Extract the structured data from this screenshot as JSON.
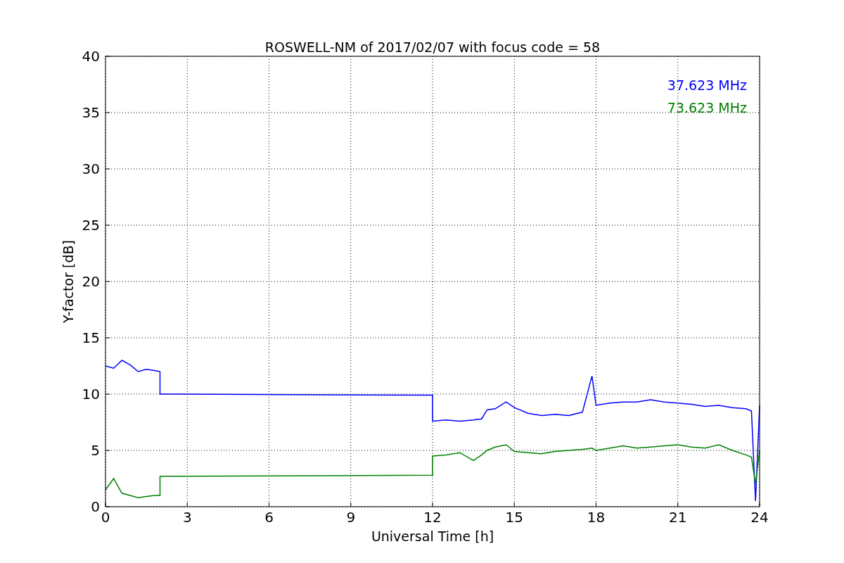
{
  "figure": {
    "chart_data": {
      "type": "line",
      "title": "ROSWELL-NM of 2017/02/07 with focus code = 58",
      "xlabel": "Universal Time [h]",
      "ylabel": "Y-factor [dB]",
      "x": [
        0,
        0.3,
        0.6,
        0.9,
        1.2,
        1.5,
        1.8,
        2,
        2,
        12,
        12,
        12.5,
        13,
        13.5,
        13.8,
        14,
        14.3,
        14.7,
        15,
        15.5,
        16,
        16.5,
        17,
        17.5,
        17.85,
        18,
        18.5,
        19,
        19.5,
        20,
        20.5,
        21,
        21.5,
        22,
        22.5,
        23,
        23.5,
        23.7,
        23.85,
        24
      ],
      "series": [
        {
          "name": "37.623 MHz",
          "color": "#0000ff",
          "values": [
            12.5,
            12.3,
            13.0,
            12.6,
            12.0,
            12.2,
            12.1,
            12.0,
            10.0,
            9.9,
            7.6,
            7.7,
            7.6,
            7.7,
            7.8,
            8.6,
            8.7,
            9.3,
            8.8,
            8.3,
            8.1,
            8.2,
            8.1,
            8.4,
            11.6,
            9.0,
            9.2,
            9.3,
            9.3,
            9.5,
            9.3,
            9.2,
            9.1,
            8.9,
            9.0,
            8.8,
            8.7,
            8.5,
            0.5,
            9.0
          ]
        },
        {
          "name": "73.623 MHz",
          "color": "#008000",
          "values": [
            1.5,
            2.5,
            1.2,
            1.0,
            0.8,
            0.9,
            1.0,
            1.0,
            2.7,
            2.8,
            4.5,
            4.6,
            4.8,
            4.1,
            4.6,
            5.0,
            5.3,
            5.5,
            4.9,
            4.8,
            4.7,
            4.9,
            5.0,
            5.1,
            5.2,
            5.0,
            5.2,
            5.4,
            5.2,
            5.3,
            5.4,
            5.5,
            5.3,
            5.2,
            5.5,
            5.0,
            4.6,
            4.4,
            2.0,
            5.0
          ]
        }
      ],
      "xlim": [
        0,
        24
      ],
      "ylim": [
        0,
        40
      ],
      "xticks": [
        0,
        3,
        6,
        9,
        12,
        15,
        18,
        21,
        24
      ],
      "yticks": [
        0,
        5,
        10,
        15,
        20,
        25,
        30,
        35,
        40
      ],
      "grid": true
    }
  }
}
